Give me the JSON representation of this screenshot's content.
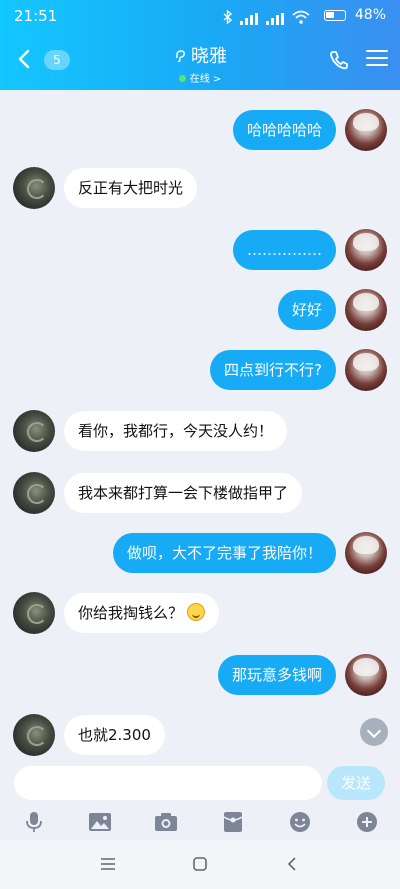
{
  "status_bar": {
    "time": "21:51",
    "battery": "48%"
  },
  "header": {
    "unread_count": "5",
    "contact_name": "晓雅",
    "presence": "在线 >"
  },
  "messages": [
    {
      "from": "me",
      "text": "哈哈哈哈哈"
    },
    {
      "from": "other",
      "text": "反正有大把时光"
    },
    {
      "from": "me",
      "text": "……………"
    },
    {
      "from": "me",
      "text": "好好"
    },
    {
      "from": "me",
      "text": "四点到行不行?"
    },
    {
      "from": "other",
      "text": "看你，我都行，今天没人约！"
    },
    {
      "from": "other",
      "text": "我本来都打算一会下楼做指甲了"
    },
    {
      "from": "me",
      "text": "做呗，大不了完事了我陪你！"
    },
    {
      "from": "other",
      "text": "你给我掏钱么？",
      "emoji": "smile-emoji-icon"
    },
    {
      "from": "me",
      "text": "那玩意多钱啊"
    },
    {
      "from": "other",
      "text": "也就2.300"
    }
  ],
  "input": {
    "value": "",
    "placeholder": ""
  },
  "send_label": "发送",
  "toolbar_icons": [
    "microphone-icon",
    "image-icon",
    "camera-icon",
    "red-packet-icon",
    "emoji-icon",
    "plus-icon"
  ],
  "nav_icons": [
    "menu-icon",
    "home-icon",
    "back-icon"
  ],
  "colors": {
    "header_start": "#14c7ff",
    "header_end": "#3b8ff0",
    "my_bubble": "#17aaf5",
    "other_bubble": "#ffffff",
    "background": "#eef0f7",
    "send_disabled": "#b8e6fb"
  }
}
